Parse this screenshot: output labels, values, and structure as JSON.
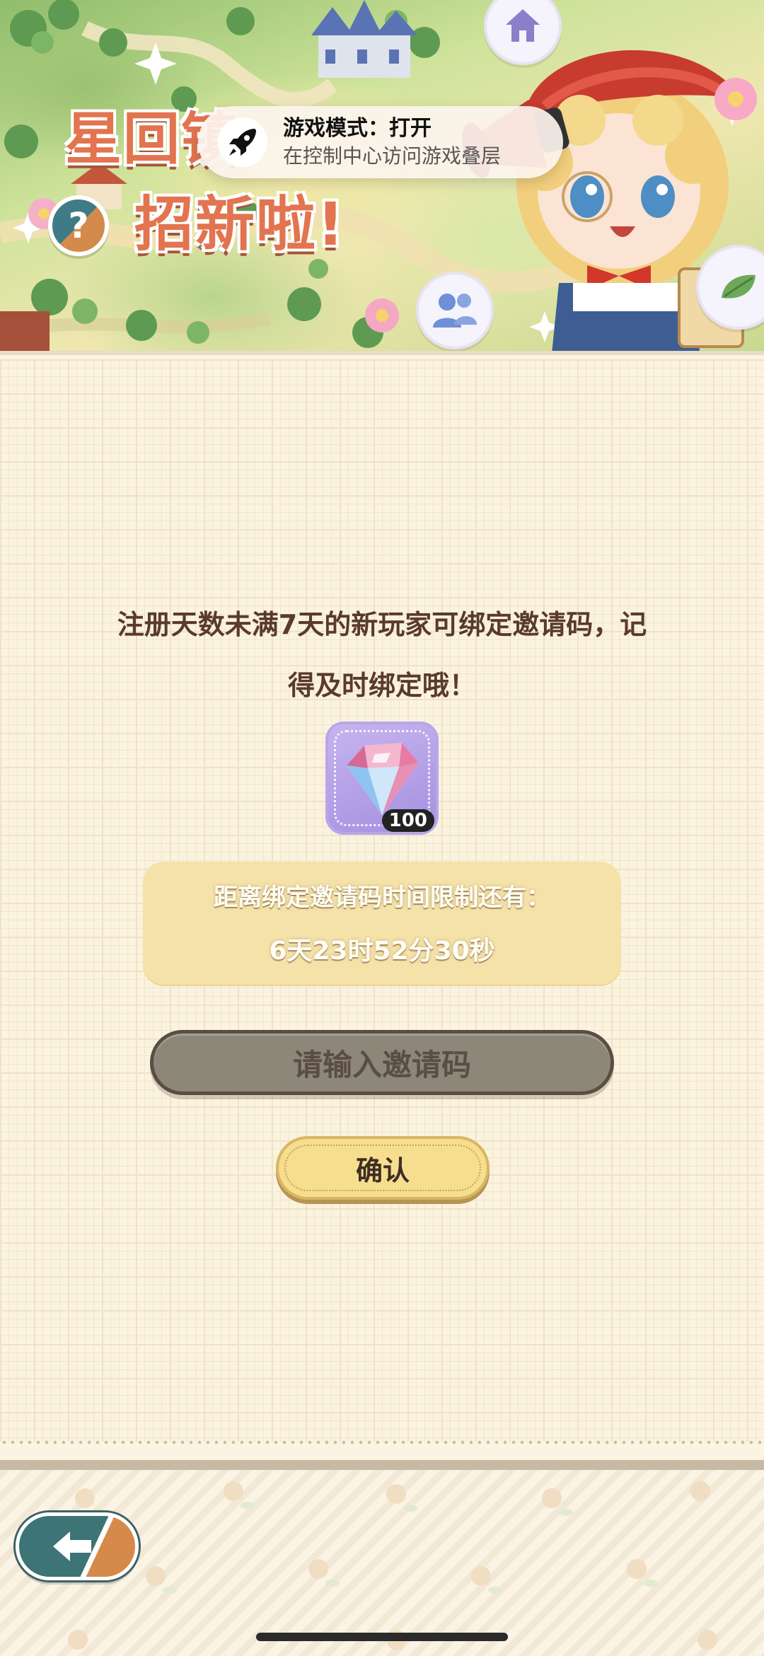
{
  "banner": {
    "title_line1": "星回镇",
    "title_line2": "招新啦!",
    "help_symbol": "?"
  },
  "toast": {
    "title": "游戏模式：打开",
    "subtitle": "在控制中心访问游戏叠层",
    "icon": "rocket-icon"
  },
  "content": {
    "notice_line1": "注册天数未满7天的新玩家可绑定邀请码，记",
    "notice_line2": "得及时绑定哦！",
    "reward": {
      "icon": "gem-icon",
      "count": "100"
    },
    "timer_label": "距离绑定邀请码时间限制还有：",
    "timer_value": "6天23时52分30秒",
    "input_placeholder": "请输入邀请码",
    "confirm_label": "确认"
  },
  "footer": {
    "back_icon": "back-arrow-icon"
  },
  "colors": {
    "background": "#fbf3de",
    "text_brown": "#5a3a2e",
    "timer_bg": "#f5e2a8",
    "input_bg": "#8c8778",
    "confirm_bg": "#f6de8e",
    "back_teal": "#3d7476",
    "back_orange": "#d58a4c"
  }
}
